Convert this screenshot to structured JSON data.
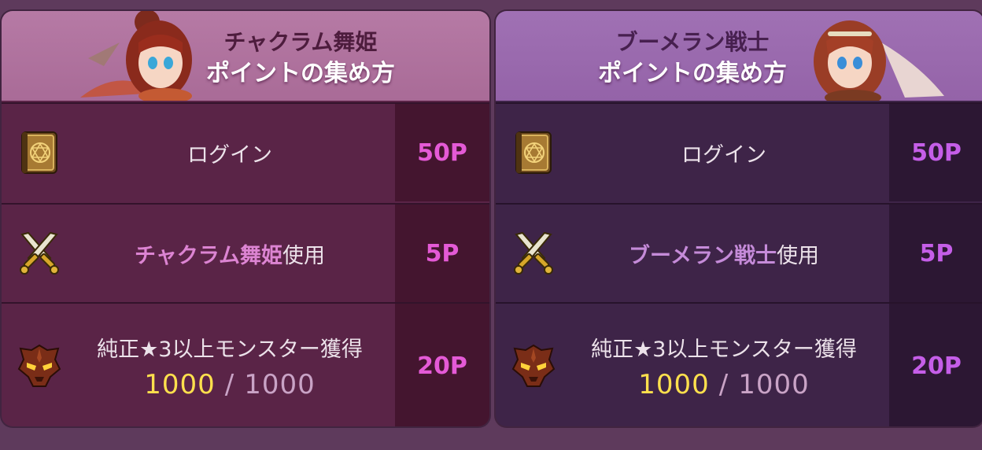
{
  "colors": {
    "background": "#5e3a5c",
    "left_header": "#b67aa5",
    "right_header": "#a071b4",
    "highlight_left": "#dc84d2",
    "highlight_right": "#c58bd9",
    "points_left": "#e45ad6",
    "points_right": "#c55ee8",
    "progress_current": "#ffe04d"
  },
  "panels": [
    {
      "title_line1": "チャクラム舞姫",
      "title_line2": "ポイントの集め方",
      "portrait_icon": "chakram-dancer-portrait",
      "rows": [
        {
          "icon": "spellbook-icon",
          "label": "ログイン",
          "points": "50P"
        },
        {
          "icon": "crossed-swords-icon",
          "highlight": "チャクラム舞姫",
          "suffix": "使用",
          "points": "5P"
        },
        {
          "icon": "monster-mask-icon",
          "label": "純正★3以上モンスター獲得",
          "progress_current": "1000",
          "progress_sep": "/",
          "progress_max": "1000",
          "points": "20P"
        }
      ]
    },
    {
      "title_line1": "ブーメラン戦士",
      "title_line2": "ポイントの集め方",
      "portrait_icon": "boomerang-warrior-portrait",
      "rows": [
        {
          "icon": "spellbook-icon",
          "label": "ログイン",
          "points": "50P"
        },
        {
          "icon": "crossed-swords-icon",
          "highlight": "ブーメラン戦士",
          "suffix": "使用",
          "points": "5P"
        },
        {
          "icon": "monster-mask-icon",
          "label": "純正★3以上モンスター獲得",
          "progress_current": "1000",
          "progress_sep": "/",
          "progress_max": "1000",
          "points": "20P"
        }
      ]
    }
  ]
}
